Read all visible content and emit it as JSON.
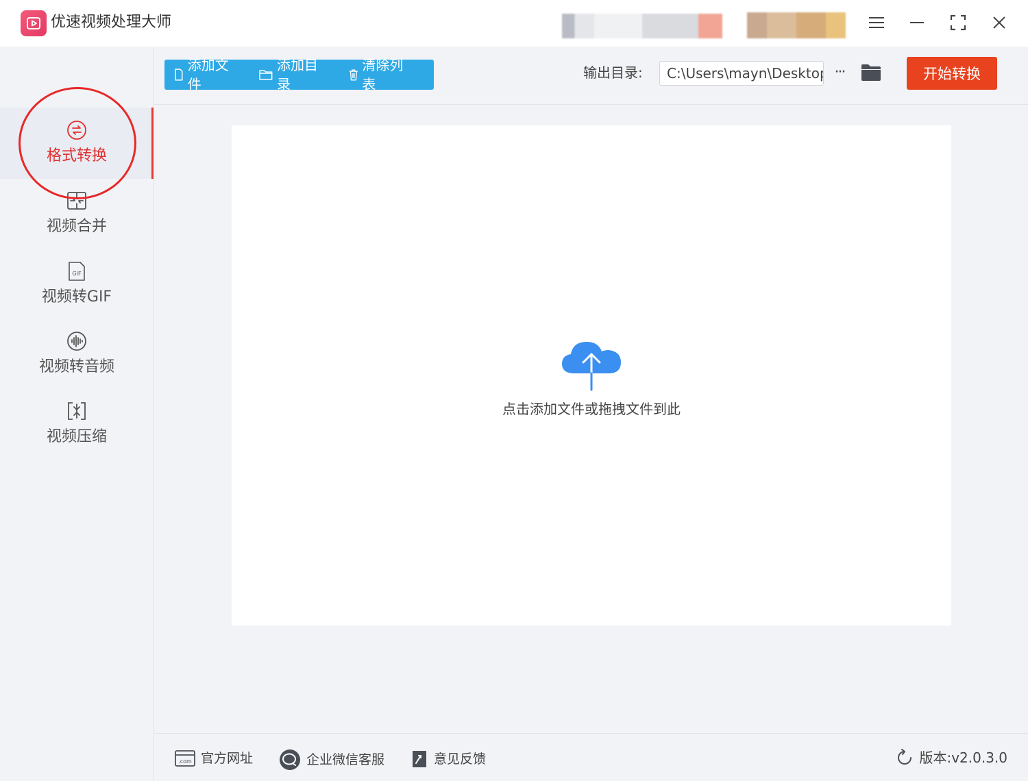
{
  "app": {
    "title": "优速视频处理大师"
  },
  "window_controls": {
    "menu": "menu-icon",
    "minimize": "minimize-icon",
    "maximize": "maximize-icon",
    "close": "close-icon"
  },
  "sidebar": {
    "items": [
      {
        "label": "格式转换",
        "icon": "convert-icon",
        "active": true
      },
      {
        "label": "视频合并",
        "icon": "merge-icon",
        "active": false
      },
      {
        "label": "视频转GIF",
        "icon": "gif-icon",
        "active": false
      },
      {
        "label": "视频转音频",
        "icon": "audio-icon",
        "active": false
      },
      {
        "label": "视频压缩",
        "icon": "compress-icon",
        "active": false
      }
    ],
    "gif_badge": "GIF"
  },
  "toolbar": {
    "add_file": "添加文件",
    "add_folder": "添加目录",
    "clear_list": "清除列表",
    "output_label": "输出目录:",
    "output_path": "C:\\Users\\mayn\\Desktop",
    "more": "···",
    "start": "开始转换"
  },
  "drop_area": {
    "hint": "点击添加文件或拖拽文件到此"
  },
  "footer": {
    "website": "官方网址",
    "wechat_service": "企业微信客服",
    "feedback": "意见反馈",
    "version": "版本:v2.0.3.0"
  },
  "colors": {
    "accent_blue": "#2fa9e6",
    "start_button": "#e8421e",
    "active_red": "#e23030",
    "cloud_blue": "#3a8ff0"
  }
}
